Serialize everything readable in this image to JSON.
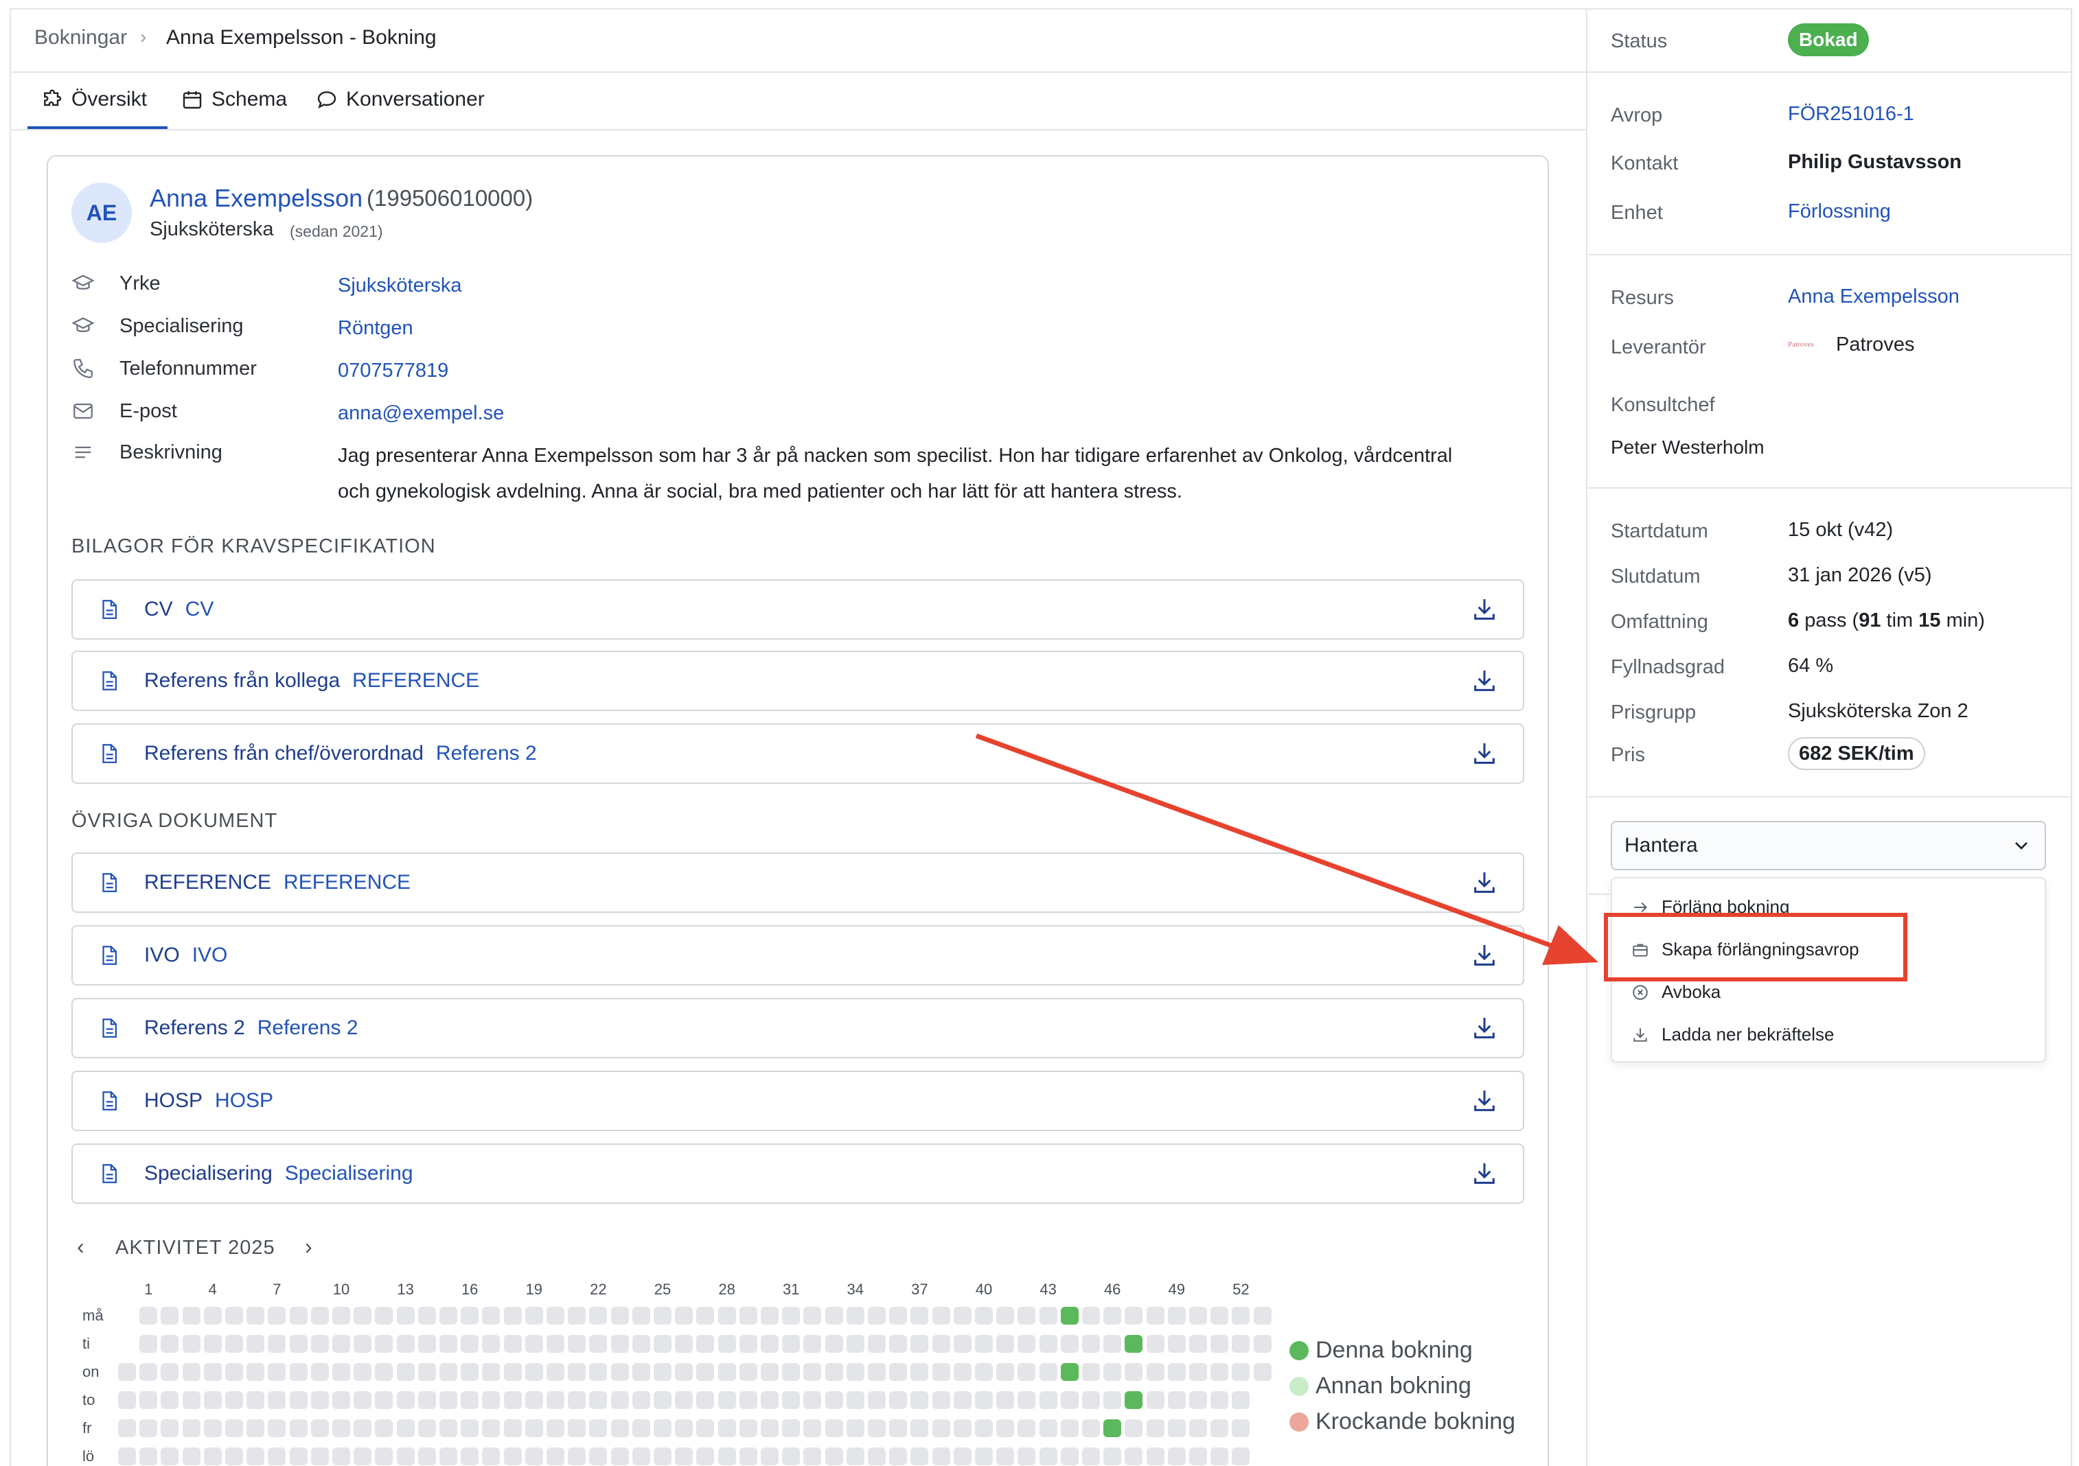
{
  "breadcrumb": {
    "parent": "Bokningar",
    "current": "Anna Exempelsson - Bokning"
  },
  "tabs": [
    {
      "label": "Översikt",
      "icon": "puzzle-icon",
      "active": true
    },
    {
      "label": "Schema",
      "icon": "calendar-icon"
    },
    {
      "label": "Konversationer",
      "icon": "chat-bubble-icon"
    }
  ],
  "profile": {
    "initials": "AE",
    "name": "Anna Exempelsson",
    "personal_number": "(199506010000)",
    "role": "Sjuksköterska",
    "since": "(sedan 2021)"
  },
  "fields": [
    {
      "label": "Yrke",
      "value": "Sjuksköterska",
      "icon": "graduation-cap-icon"
    },
    {
      "label": "Specialisering",
      "value": "Röntgen",
      "icon": "graduation-cap-icon"
    },
    {
      "label": "Telefonnummer",
      "value": "0707577819",
      "icon": "phone-icon"
    },
    {
      "label": "E-post",
      "value": "anna@exempel.se",
      "icon": "mail-icon"
    },
    {
      "label": "Beskrivning",
      "icon": "text-lines-icon"
    }
  ],
  "description_line1": "Jag presenterar Anna Exempelsson som har 3 år på nacken som specilist. Hon har tidigare erfarenhet av Onkolog, vårdcentral",
  "description_line2": "och gynekologisk avdelning. Anna är social, bra med patienter och har lätt för att hantera stress.",
  "attachments_title": "BILAGOR FÖR KRAVSPECIFIKATION",
  "attachments": [
    {
      "name": "CV",
      "type": "CV"
    },
    {
      "name": "Referens från kollega",
      "type": "REFERENCE"
    },
    {
      "name": "Referens från chef/överordnad",
      "type": "Referens 2"
    }
  ],
  "other_title": "ÖVRIGA DOKUMENT",
  "other_docs": [
    {
      "name": "REFERENCE",
      "type": "REFERENCE"
    },
    {
      "name": "IVO",
      "type": "IVO"
    },
    {
      "name": "Referens 2",
      "type": "Referens 2"
    },
    {
      "name": "HOSP",
      "type": "HOSP"
    },
    {
      "name": "Specialisering",
      "type": "Specialisering"
    }
  ],
  "activity": {
    "title": "AKTIVITET 2025",
    "week_labels": [
      "1",
      "4",
      "7",
      "10",
      "13",
      "16",
      "19",
      "22",
      "25",
      "28",
      "31",
      "34",
      "37",
      "40",
      "43",
      "46",
      "49",
      "52"
    ],
    "day_labels": [
      "må",
      "ti",
      "on",
      "to",
      "fr",
      "lö"
    ],
    "bookings": [
      {
        "day": "må",
        "week": 44
      },
      {
        "day": "ti",
        "week": 47
      },
      {
        "day": "on",
        "week": 44
      },
      {
        "day": "to",
        "week": 47
      },
      {
        "day": "fr",
        "week": 46
      }
    ],
    "legend": [
      {
        "label": "Denna bokning",
        "color": "#5cb85c"
      },
      {
        "label": "Annan bokning",
        "color": "#c9ecc9"
      },
      {
        "label": "Krockande bokning",
        "color": "#eaa79a"
      }
    ],
    "colors": {
      "empty": "#e4e5e8",
      "this_booking": "#5cb85c"
    }
  },
  "sidebar": {
    "status_label": "Status",
    "status_value": "Bokad",
    "avrop_label": "Avrop",
    "avrop_value": "FÖR251016-1",
    "kontakt_label": "Kontakt",
    "kontakt_value": "Philip Gustavsson",
    "enhet_label": "Enhet",
    "enhet_value": "Förlossning",
    "resurs_label": "Resurs",
    "resurs_value": "Anna Exempelsson",
    "leverantor_label": "Leverantör",
    "leverantor_logo": "Patroves",
    "leverantor_value": "Patroves",
    "konsultchef_label": "Konsultchef",
    "konsultchef_value": "Peter Westerholm",
    "startdatum_label": "Startdatum",
    "startdatum_value": "15 okt (v42)",
    "slutdatum_label": "Slutdatum",
    "slutdatum_value": "31 jan 2026 (v5)",
    "omfattning_label": "Omfattning",
    "omfattning_pass": "6",
    "omfattning_pass_unit": "pass (",
    "omfattning_hours": "91",
    "omfattning_hours_unit": "tim",
    "omfattning_minutes": "15",
    "omfattning_minutes_unit": "min)",
    "fyllnadsgrad_label": "Fyllnadsgrad",
    "fyllnadsgrad_value": "64 %",
    "prisgrupp_label": "Prisgrupp",
    "prisgrupp_value": "Sjuksköterska Zon 2",
    "pris_label": "Pris",
    "pris_value": "682 SEK/tim"
  },
  "manage": {
    "label": "Hantera",
    "items": [
      {
        "label": "Förläng bokning",
        "icon": "arrow-right-icon"
      },
      {
        "label": "Skapa förlängningsavrop",
        "icon": "briefcase-icon"
      },
      {
        "label": "Avboka",
        "icon": "x-circle-icon"
      },
      {
        "label": "Ladda ner bekräftelse",
        "icon": "download-icon"
      }
    ]
  },
  "annotation_color": "#e5432f"
}
